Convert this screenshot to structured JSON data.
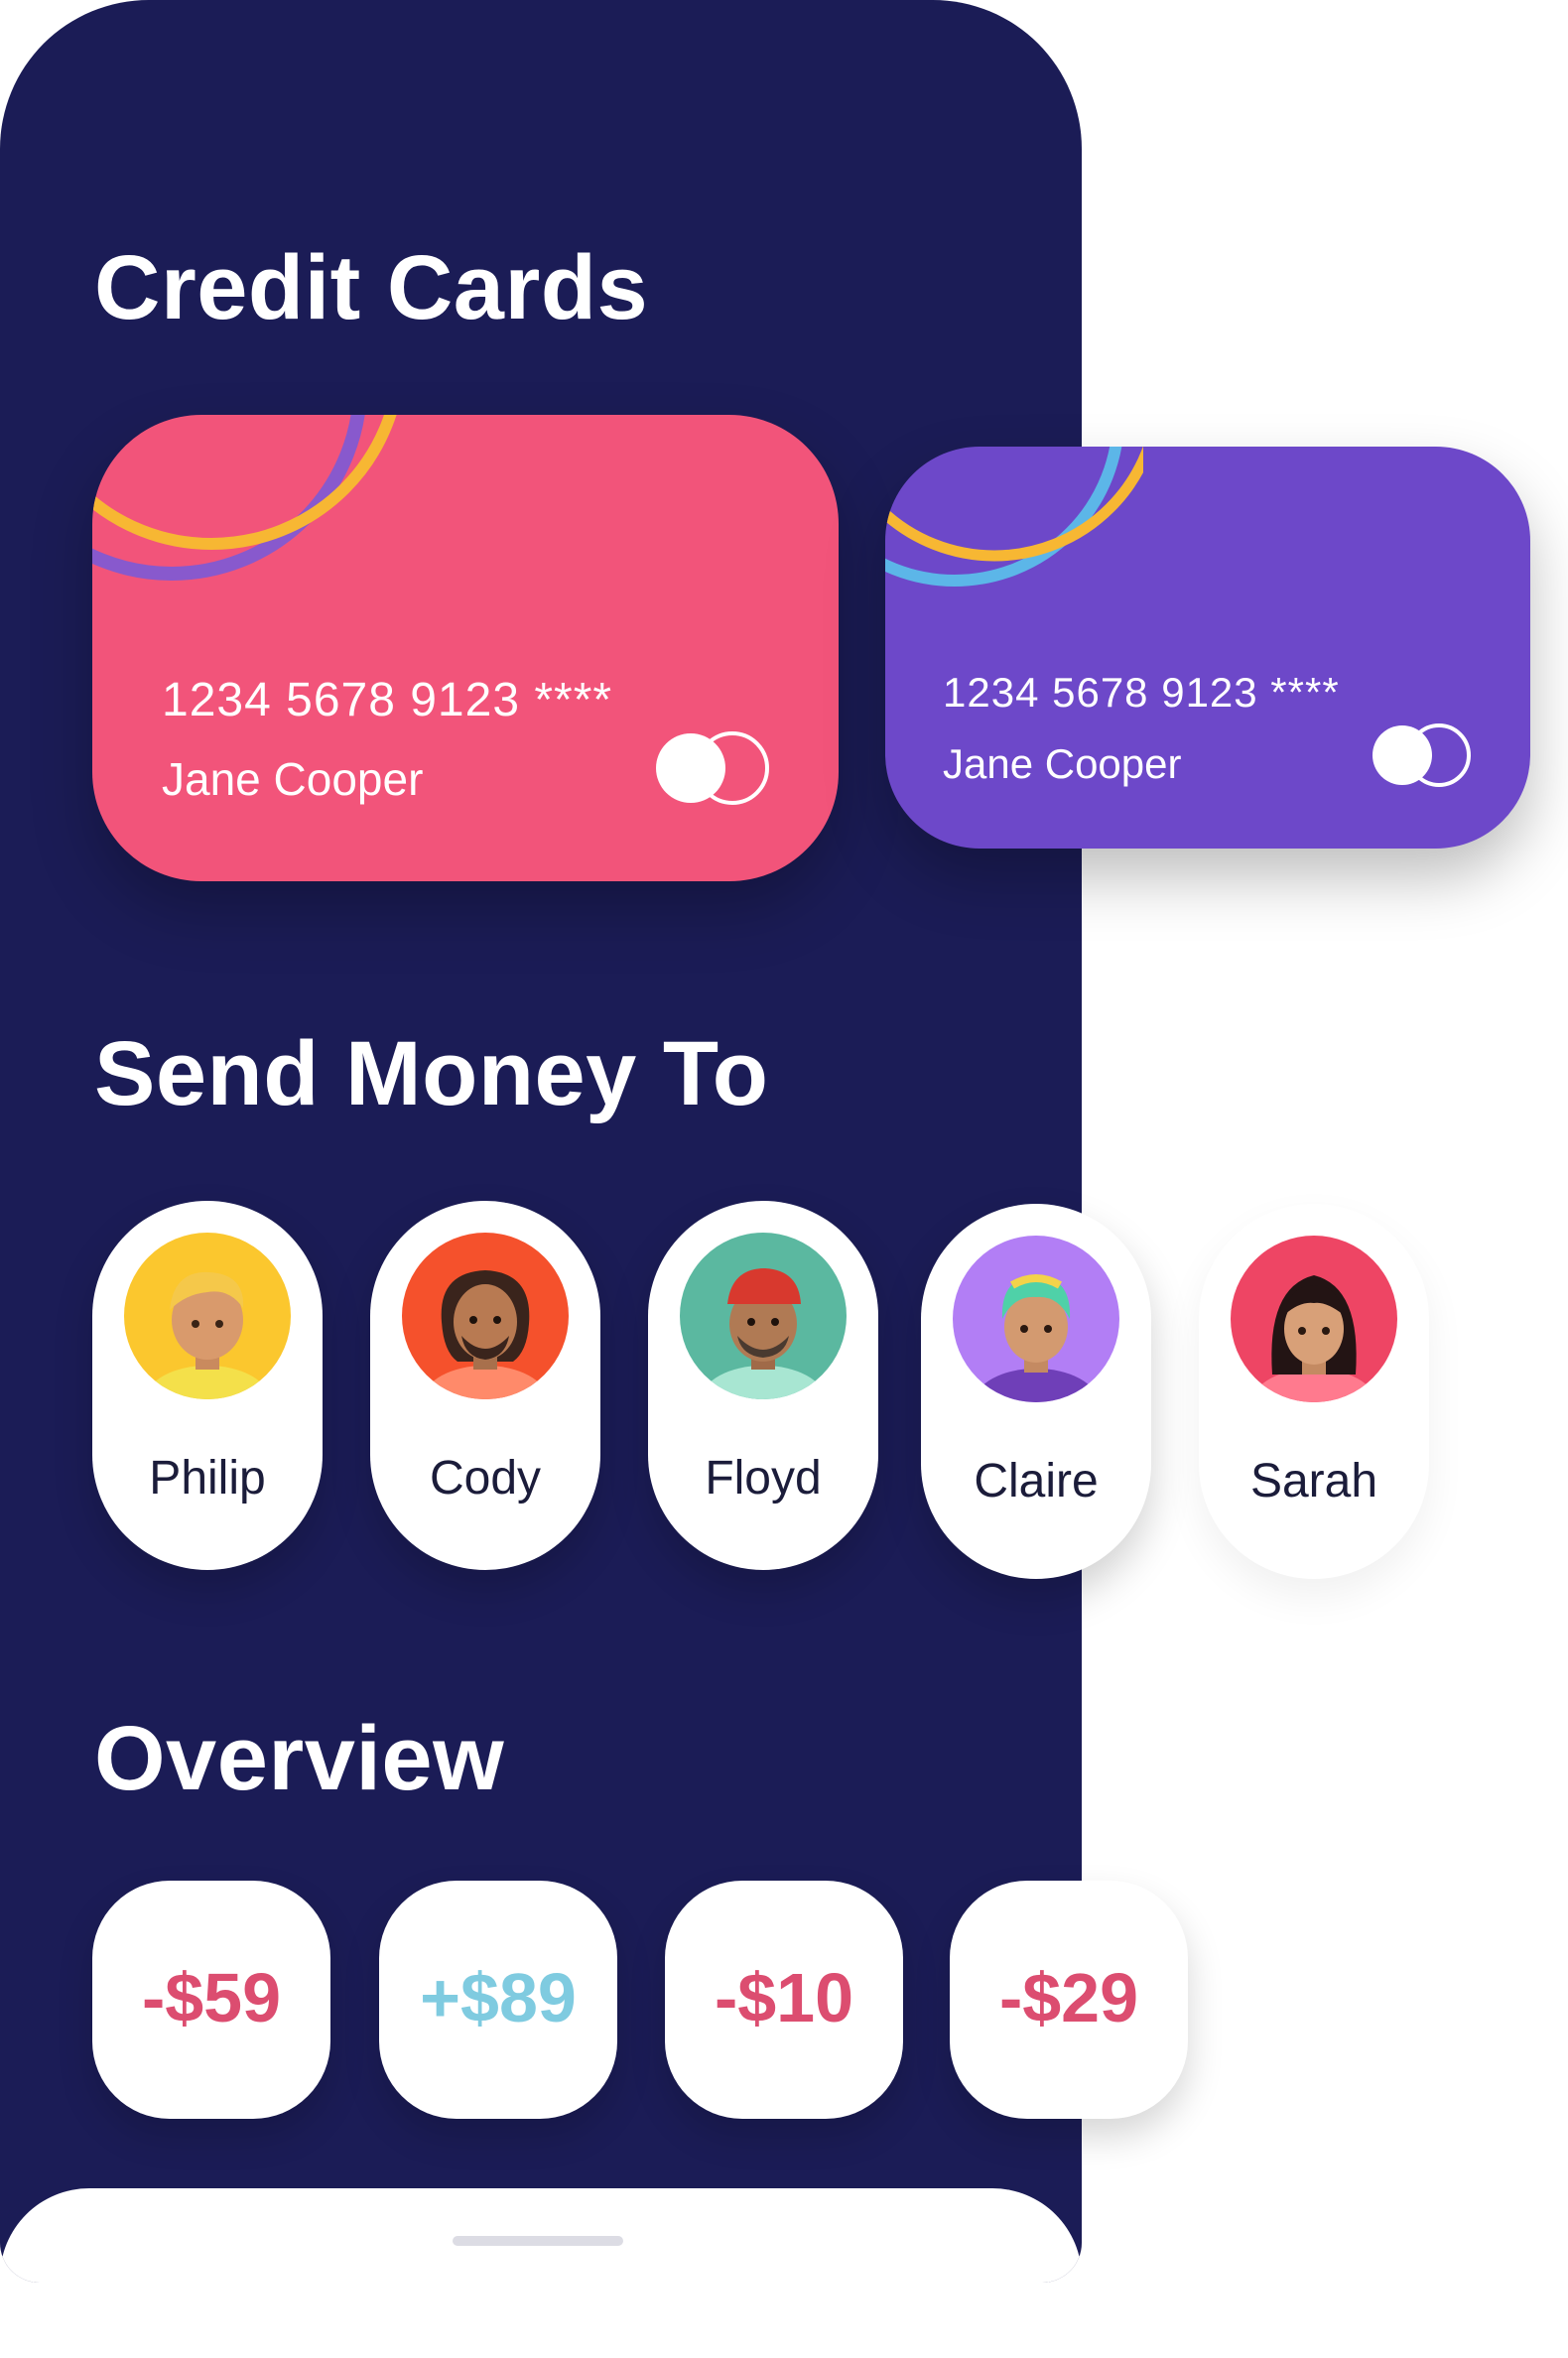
{
  "sections": {
    "credit_cards_title": "Credit Cards",
    "send_money_title": "Send Money To",
    "overview_title": "Overview"
  },
  "cards": [
    {
      "number": "1234 5678 9123 ****",
      "holder": "Jane Cooper",
      "color": "#f2547a"
    },
    {
      "number": "1234 5678 9123 ****",
      "holder": "Jane Cooper",
      "color": "#6d48c9"
    }
  ],
  "contacts": [
    {
      "name": "Philip",
      "avatar_bg": "#fbc72e"
    },
    {
      "name": "Cody",
      "avatar_bg": "#f5512c"
    },
    {
      "name": "Floyd",
      "avatar_bg": "#5bb8a0"
    },
    {
      "name": "Claire",
      "avatar_bg": "#b27ef5"
    },
    {
      "name": "Sarah",
      "avatar_bg": "#ee4564"
    }
  ],
  "overview": [
    {
      "amount": "-$59",
      "kind": "negative"
    },
    {
      "amount": "+$89",
      "kind": "positive"
    },
    {
      "amount": "-$10",
      "kind": "negative"
    },
    {
      "amount": "-$29",
      "kind": "negative"
    }
  ],
  "colors": {
    "background": "#1b1c56",
    "negative": "#dc4d70",
    "positive": "#7fcbe0"
  }
}
